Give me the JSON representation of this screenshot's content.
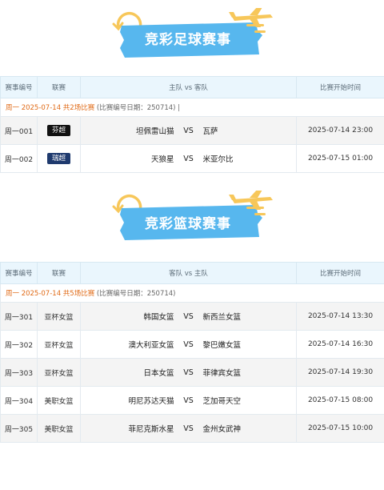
{
  "football": {
    "title": "竞彩足球赛事",
    "headers": [
      "赛事编号",
      "联赛",
      "主队 vs 客队",
      "比赛开始时间"
    ],
    "date_line": {
      "date": "周一 2025-07-14 共2场比赛",
      "extra": "(比赛编号日期：250714)",
      "sep": "|"
    },
    "rows": [
      {
        "code": "周一001",
        "league": "芬超",
        "league_color": "#111111",
        "home": "坦佩雷山猫",
        "vs": "VS",
        "away": "瓦萨",
        "time": "2025-07-14 23:00"
      },
      {
        "code": "周一002",
        "league": "瑞超",
        "league_color": "#1f3a6e",
        "home": "天狼星",
        "vs": "VS",
        "away": "米亚尔比",
        "time": "2025-07-15 01:00"
      }
    ]
  },
  "basketball": {
    "title": "竞彩篮球赛事",
    "headers": [
      "赛事编号",
      "联赛",
      "客队 vs 主队",
      "比赛开始时间"
    ],
    "date_line": {
      "date": "周一 2025-07-14 共5场比赛",
      "extra": "(比赛编号日期：250714)"
    },
    "rows": [
      {
        "code": "周一301",
        "league": "亚杯女篮",
        "home": "韩国女篮",
        "vs": "VS",
        "away": "新西兰女篮",
        "time": "2025-07-14 13:30"
      },
      {
        "code": "周一302",
        "league": "亚杯女篮",
        "home": "澳大利亚女篮",
        "vs": "VS",
        "away": "黎巴嫩女篮",
        "time": "2025-07-14 16:30"
      },
      {
        "code": "周一303",
        "league": "亚杯女篮",
        "home": "日本女篮",
        "vs": "VS",
        "away": "菲律宾女篮",
        "time": "2025-07-14 19:30"
      },
      {
        "code": "周一304",
        "league": "美职女篮",
        "home": "明尼苏达天猫",
        "vs": "VS",
        "away": "芝加哥天空",
        "time": "2025-07-15 08:00"
      },
      {
        "code": "周一305",
        "league": "美职女篮",
        "home": "菲尼克斯水星",
        "vs": "VS",
        "away": "金州女武神",
        "time": "2025-07-15 10:00"
      }
    ]
  },
  "colors": {
    "header_bg": "#eaf6fd",
    "date_orange": "#e06a16",
    "banner_blue": "#57b7ee",
    "banner_yellow": "#f7c75a"
  },
  "icons": [
    "airplane-icon",
    "arc-arrow-icon"
  ]
}
